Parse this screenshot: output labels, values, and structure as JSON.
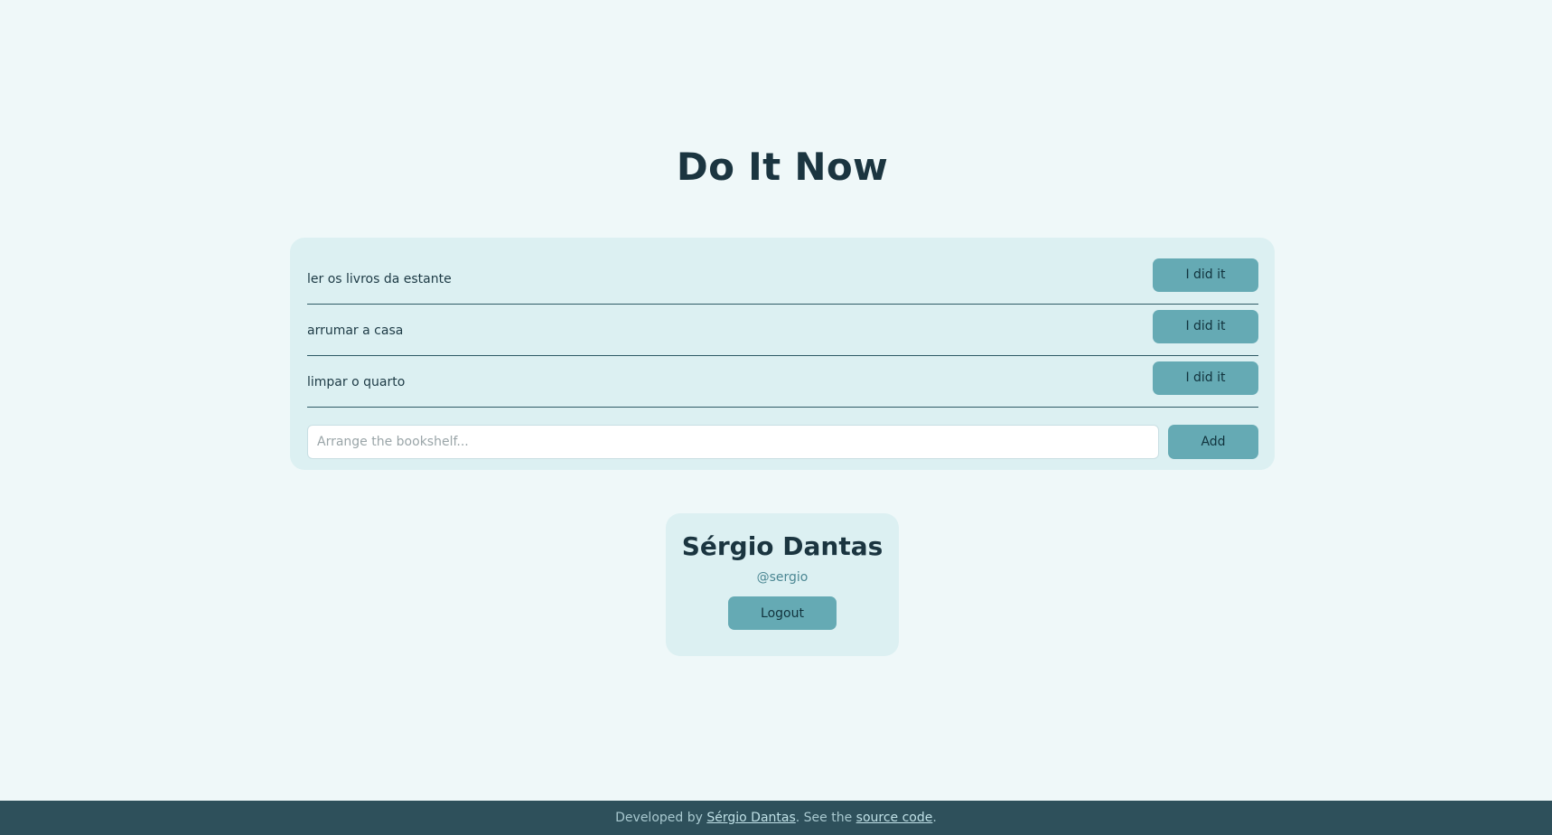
{
  "header": {
    "title": "Do It Now"
  },
  "tasks": [
    {
      "text": "ler os livros da estante",
      "button_label": "I did it"
    },
    {
      "text": "arrumar a casa",
      "button_label": "I did it"
    },
    {
      "text": "limpar o quarto",
      "button_label": "I did it"
    }
  ],
  "new_task": {
    "value": "",
    "placeholder": "Arrange the bookshelf...",
    "add_label": "Add"
  },
  "profile": {
    "name": "Sérgio Dantas",
    "handle": "@sergio",
    "logout_label": "Logout"
  },
  "footer": {
    "prefix": "Developed by ",
    "author_link": "Sérgio Dantas",
    "middle": ". See the ",
    "source_link": "source code",
    "suffix": "."
  },
  "colors": {
    "background": "#eff8f9",
    "card": "#dcf0f2",
    "button": "#65aab4",
    "footer": "#2e505b",
    "title": "#1b3540"
  }
}
